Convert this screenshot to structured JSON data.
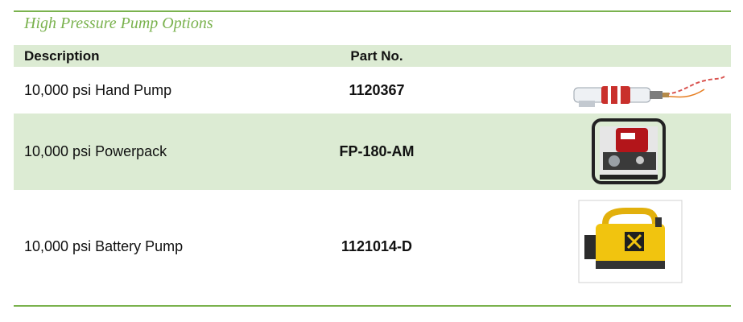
{
  "title": "High Pressure Pump Options",
  "table": {
    "headers": {
      "description": "Description",
      "part_no": "Part No."
    },
    "rows": [
      {
        "description": "10,000 psi Hand Pump",
        "part_no": "1120367",
        "image": "hand-pump-image"
      },
      {
        "description": "10,000 psi Powerpack",
        "part_no": "FP-180-AM",
        "image": "powerpack-image"
      },
      {
        "description": "10,000 psi Battery Pump",
        "part_no": "1121014-D",
        "image": "battery-pump-image"
      }
    ]
  },
  "colors": {
    "accent": "#7ab24e",
    "row_shade": "#dcebd3",
    "text": "#111111"
  }
}
